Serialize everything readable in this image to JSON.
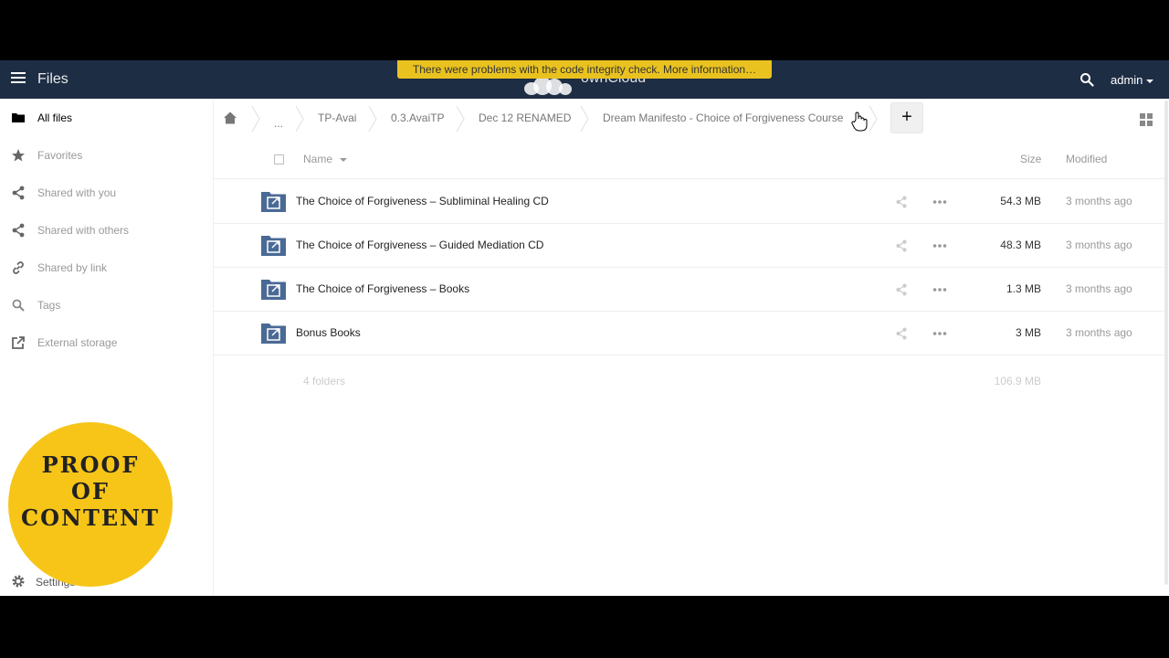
{
  "header": {
    "app_name": "Files",
    "brand": "ownCloud",
    "warning": "There were problems with the code integrity check. More information…",
    "user": "admin"
  },
  "sidebar": {
    "items": [
      {
        "label": "All files",
        "icon": "folder-icon",
        "active": true
      },
      {
        "label": "Favorites",
        "icon": "star-icon"
      },
      {
        "label": "Shared with you",
        "icon": "share-icon"
      },
      {
        "label": "Shared with others",
        "icon": "share-icon"
      },
      {
        "label": "Shared by link",
        "icon": "link-icon"
      },
      {
        "label": "Tags",
        "icon": "search-icon"
      },
      {
        "label": "External storage",
        "icon": "external-link-icon"
      }
    ],
    "settings_label": "Settings"
  },
  "badge": {
    "line1": "PROOF",
    "line2": "OF",
    "line3": "CONTENT"
  },
  "breadcrumbs": {
    "ellipsis": "...",
    "items": [
      "TP-Avai",
      "0.3.AvaiTP",
      "Dec 12 RENAMED",
      "Dream Manifesto - Choice of Forgiveness Course"
    ],
    "new_label": "+"
  },
  "columns": {
    "name": "Name",
    "size": "Size",
    "modified": "Modified"
  },
  "files": [
    {
      "name": "The Choice of Forgiveness – Subliminal Healing CD",
      "size": "54.3 MB",
      "modified": "3 months ago"
    },
    {
      "name": "The Choice of Forgiveness – Guided Mediation CD",
      "size": "48.3 MB",
      "modified": "3 months ago"
    },
    {
      "name": "The Choice of Forgiveness – Books",
      "size": "1.3 MB",
      "modified": "3 months ago"
    },
    {
      "name": "Bonus Books",
      "size": "3 MB",
      "modified": "3 months ago"
    }
  ],
  "summary": {
    "count": "4 folders",
    "size": "106.9 MB"
  },
  "colors": {
    "header_bg": "#1d2d44",
    "warning_bg": "#e9c21f",
    "folder_blue": "#4a6a95",
    "badge_yellow": "#f6c518"
  }
}
